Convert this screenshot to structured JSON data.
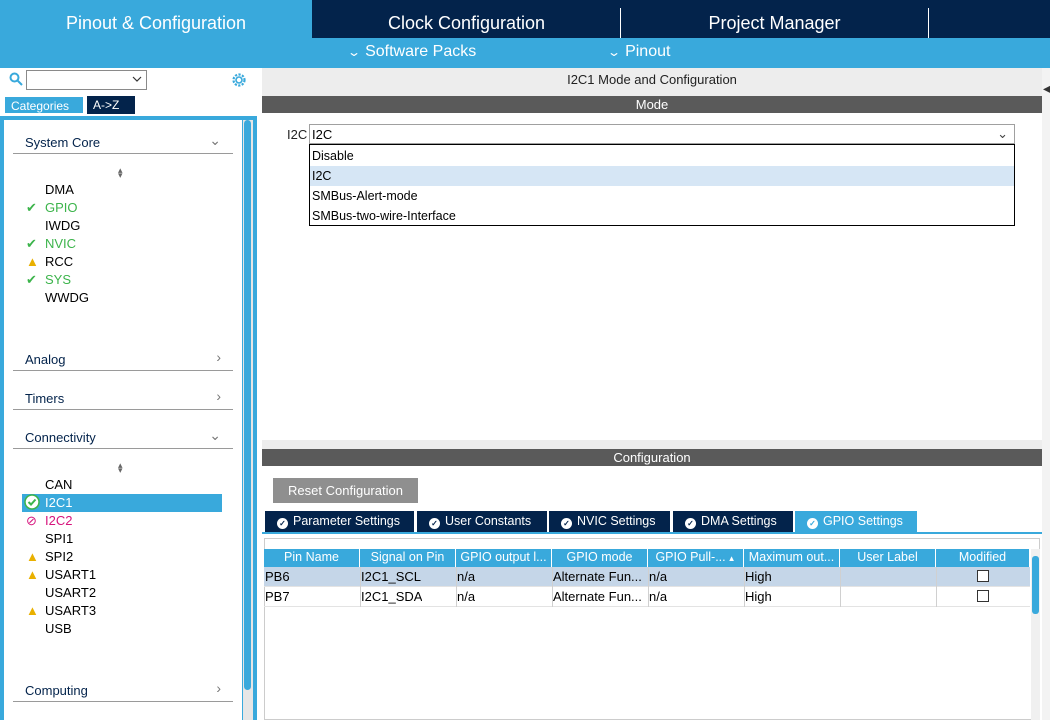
{
  "top_tabs": {
    "pinout": "Pinout & Configuration",
    "clock": "Clock Configuration",
    "project": "Project Manager"
  },
  "sub_bar": {
    "software_packs": "Software Packs",
    "pinout": "Pinout"
  },
  "left": {
    "search_value": "",
    "categories_tab": "Categories",
    "az_tab": "A->Z",
    "system_core": {
      "label": "System Core",
      "items": [
        "DMA",
        "GPIO",
        "IWDG",
        "NVIC",
        "RCC",
        "SYS",
        "WWDG"
      ]
    },
    "analog": "Analog",
    "timers": "Timers",
    "connectivity": {
      "label": "Connectivity",
      "items": [
        "CAN",
        "I2C1",
        "I2C2",
        "SPI1",
        "SPI2",
        "USART1",
        "USART2",
        "USART3",
        "USB"
      ]
    },
    "computing": "Computing"
  },
  "right": {
    "title": "I2C1 Mode and Configuration",
    "mode_header": "Mode",
    "i2c_label": "I2C",
    "i2c_value": "I2C",
    "options": [
      "Disable",
      "I2C",
      "SMBus-Alert-mode",
      "SMBus-two-wire-Interface"
    ],
    "config_header": "Configuration",
    "reset_button": "Reset Configuration",
    "tabs": [
      "Parameter Settings",
      "User Constants",
      "NVIC Settings",
      "DMA Settings",
      "GPIO Settings"
    ],
    "table": {
      "headers": [
        "Pin Name",
        "Signal on Pin",
        "GPIO output l...",
        "GPIO mode",
        "GPIO Pull-...",
        "Maximum out...",
        "User Label",
        "Modified"
      ],
      "rows": [
        [
          "PB6",
          "I2C1_SCL",
          "n/a",
          "Alternate Fun...",
          "n/a",
          "High",
          "",
          ""
        ],
        [
          "PB7",
          "I2C1_SDA",
          "n/a",
          "Alternate Fun...",
          "n/a",
          "High",
          "",
          ""
        ]
      ]
    }
  },
  "colors": {
    "navy": "#03234b",
    "accent": "#39a9dc",
    "ok": "#3cb44b",
    "warn": "#e9b000",
    "error": "#d6137c"
  }
}
